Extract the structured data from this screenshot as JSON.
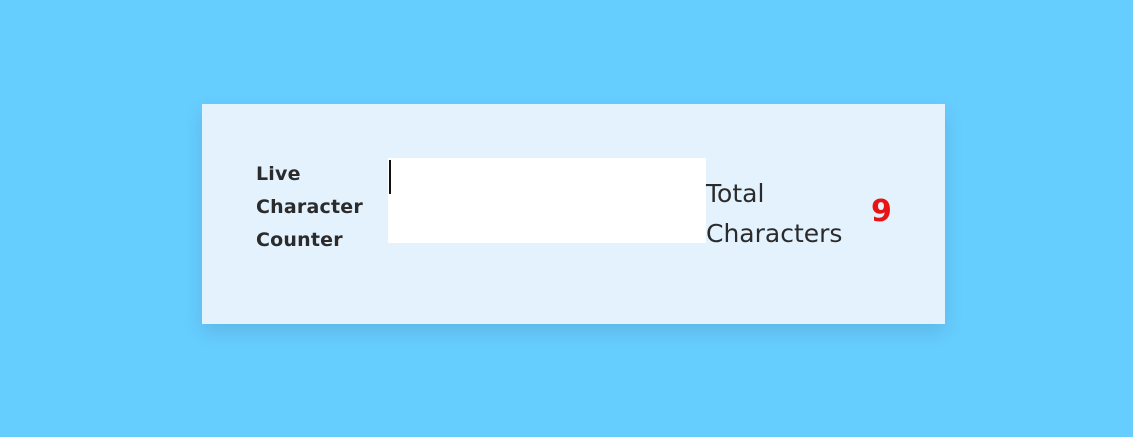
{
  "card": {
    "title": "Live Character Counter",
    "input": {
      "value": "",
      "placeholder": ""
    },
    "counter": {
      "label": "Total Characters",
      "value": "9"
    }
  },
  "colors": {
    "page_background": "#66cdff",
    "card_background": "#e3f2fd",
    "input_background": "#ffffff",
    "text": "#2b2b2b",
    "counter_value": "#e81414"
  }
}
